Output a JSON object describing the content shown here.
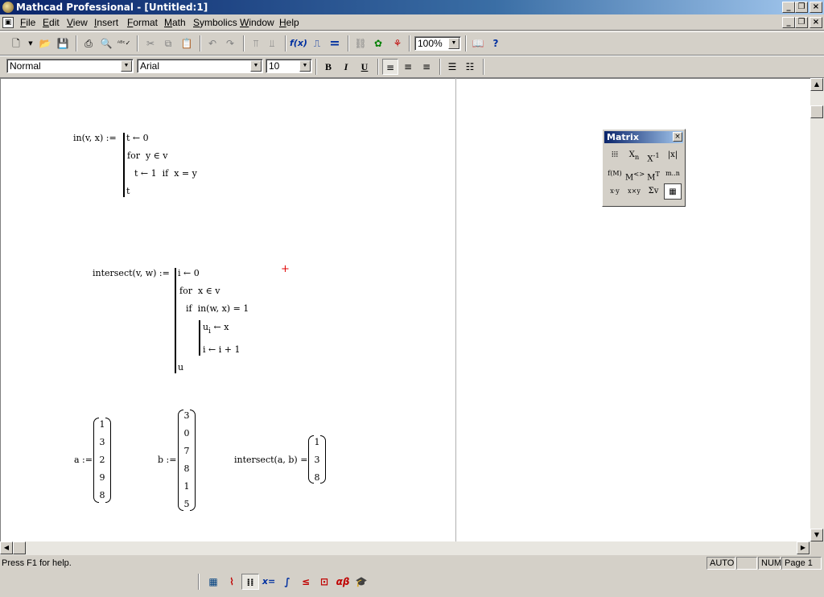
{
  "window": {
    "title": "Mathcad Professional - [Untitled:1]"
  },
  "menu": [
    "File",
    "Edit",
    "View",
    "Insert",
    "Format",
    "Math",
    "Symbolics",
    "Window",
    "Help"
  ],
  "toolbar": {
    "zoom": "100%"
  },
  "format_toolbar": {
    "style": "Normal",
    "font": "Arial",
    "size": "10",
    "bold": "B",
    "italic": "I",
    "underline": "U"
  },
  "worksheet": {
    "in_def": {
      "header": "in(v, x) :=",
      "l1": "t ← 0",
      "l2": "for  y ∈ v",
      "l3": "t ← 1  if  x = y",
      "l4": "t"
    },
    "intersect_def": {
      "header": "intersect(v, w) :=",
      "l1": "i ← 0",
      "l2": "for  x ∈ v",
      "l3": "if  in(w, x) = 1",
      "l4a": "u",
      "l4sub": "i",
      "l4b": " ← x",
      "l5": "i ← i + 1",
      "l6": "u"
    },
    "a_label": "a :=",
    "a_values": [
      "1",
      "3",
      "2",
      "9",
      "8"
    ],
    "b_label": "b :=",
    "b_values": [
      "3",
      "0",
      "7",
      "8",
      "1",
      "5"
    ],
    "result_label": "intersect(a, b) =",
    "result_values": [
      "1",
      "3",
      "8"
    ]
  },
  "matrix_palette": {
    "title": "Matrix"
  },
  "status": {
    "help": "Press F1 for help.",
    "mode": "AUTO",
    "num": "NUM",
    "page": "Page 1"
  }
}
